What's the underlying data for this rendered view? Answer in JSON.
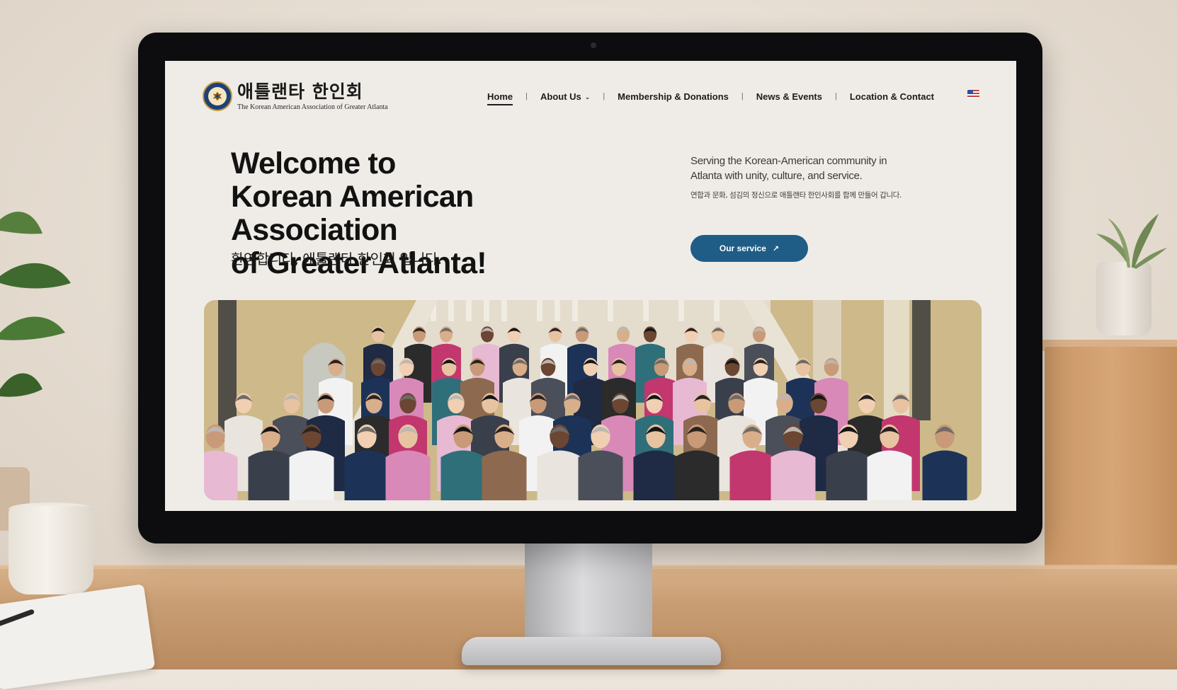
{
  "site": {
    "logo": {
      "kr": "애틀랜타 한인회",
      "en": "The Korean American Association of Greater Atlanta"
    },
    "nav": {
      "items": [
        {
          "label": "Home",
          "active": true
        },
        {
          "label": "About Us",
          "dropdown": true
        },
        {
          "label": "Membership & Donations"
        },
        {
          "label": "News & Events"
        },
        {
          "label": "Location & Contact"
        }
      ],
      "separator": "|",
      "language_icon": "us-flag-icon"
    },
    "hero": {
      "title_lines": [
        "Welcome to",
        "Korean American Association",
        "of Greater Atlanta!"
      ],
      "subtitle_kr": "환영합니다, 애틀랜타 한인회 입니다.",
      "tagline": "Serving the Korean-American community in Atlanta with unity, culture, and service.",
      "tagline_kr": "연합과 문화, 섬김의 정신으로 애틀랜타 한인사회를 함께 만들어 갑니다.",
      "cta_label": "Our service",
      "cta_icon": "arrow-up-right-icon"
    },
    "banner": {
      "alt": "group-photo"
    },
    "colors": {
      "accent": "#1f5d86",
      "page_bg": "#efece7",
      "text": "#121212"
    }
  }
}
